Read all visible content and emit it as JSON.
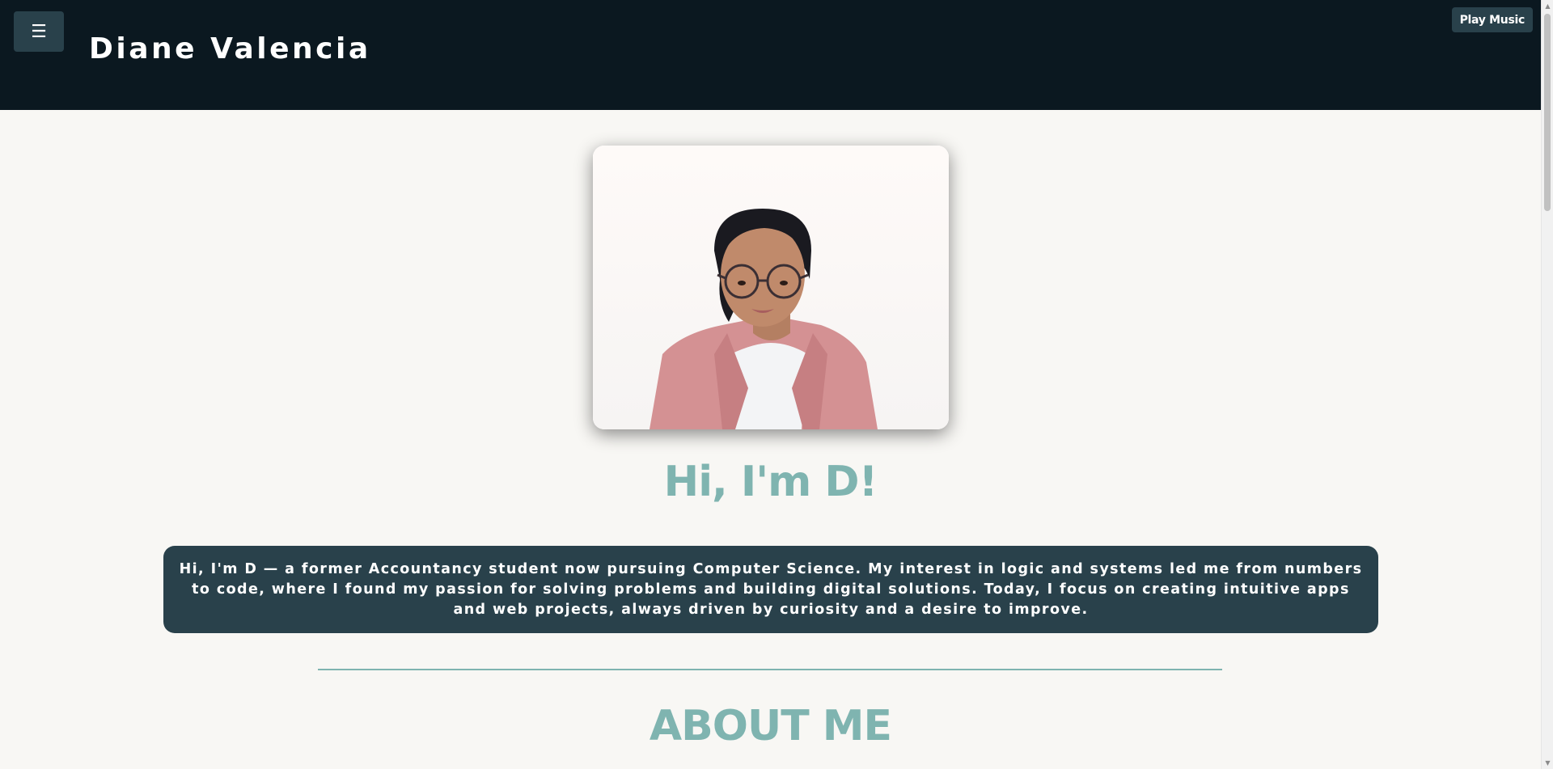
{
  "header": {
    "menu_icon": "☰",
    "site_title": "Diane Valencia",
    "music_button": "Play Music"
  },
  "hero": {
    "photo_alt": "Portrait of Diane Valencia",
    "heading": "Hi, I'm D!",
    "intro": "Hi, I'm D — a former Accountancy student now pursuing Computer Science. My interest in logic and systems led me from numbers to code, where I found my passion for solving problems and building digital solutions. Today, I focus on creating intuitive apps and web projects, always driven by curiosity and a desire to improve."
  },
  "about": {
    "heading": "ABOUT ME"
  },
  "colors": {
    "header_bg": "#0b1820",
    "button_bg": "#29414b",
    "accent": "#7fb4b0",
    "page_bg": "#f8f7f4"
  },
  "icons": {
    "menu": "hamburger-menu-icon",
    "scroll_up": "scroll-up-arrow-icon",
    "scroll_down": "scroll-down-arrow-icon"
  }
}
